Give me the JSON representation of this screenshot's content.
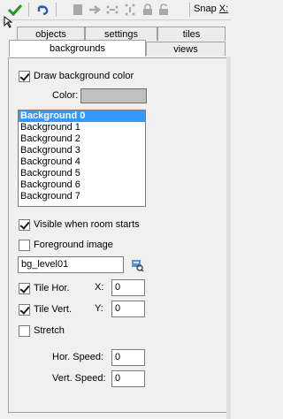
{
  "toolbar": {
    "snap_label": "Snap",
    "snap_key": "X:"
  },
  "tabs": {
    "row1": [
      "objects",
      "settings",
      "tiles"
    ],
    "row2": [
      "backgrounds",
      "views"
    ]
  },
  "panel": {
    "draw_bg_label": "Draw background color",
    "draw_bg_checked": true,
    "color_label": "Color:",
    "color_value": "#c0c0c0",
    "backgrounds": [
      "Background 0",
      "Background 1",
      "Background 2",
      "Background 3",
      "Background 4",
      "Background 5",
      "Background 6",
      "Background 7"
    ],
    "selected_index": 0,
    "visible_label": "Visible when room starts",
    "visible_checked": true,
    "foreground_label": "Foreground image",
    "foreground_checked": false,
    "image_name": "bg_level01",
    "tile_hor_label": "Tile Hor.",
    "tile_hor_checked": true,
    "tile_vert_label": "Tile Vert.",
    "tile_vert_checked": true,
    "x_label": "X:",
    "x_value": "0",
    "y_label": "Y:",
    "y_value": "0",
    "stretch_label": "Stretch",
    "stretch_checked": false,
    "hor_speed_label": "Hor. Speed:",
    "hor_speed_value": "0",
    "vert_speed_label": "Vert. Speed:",
    "vert_speed_value": "0"
  }
}
